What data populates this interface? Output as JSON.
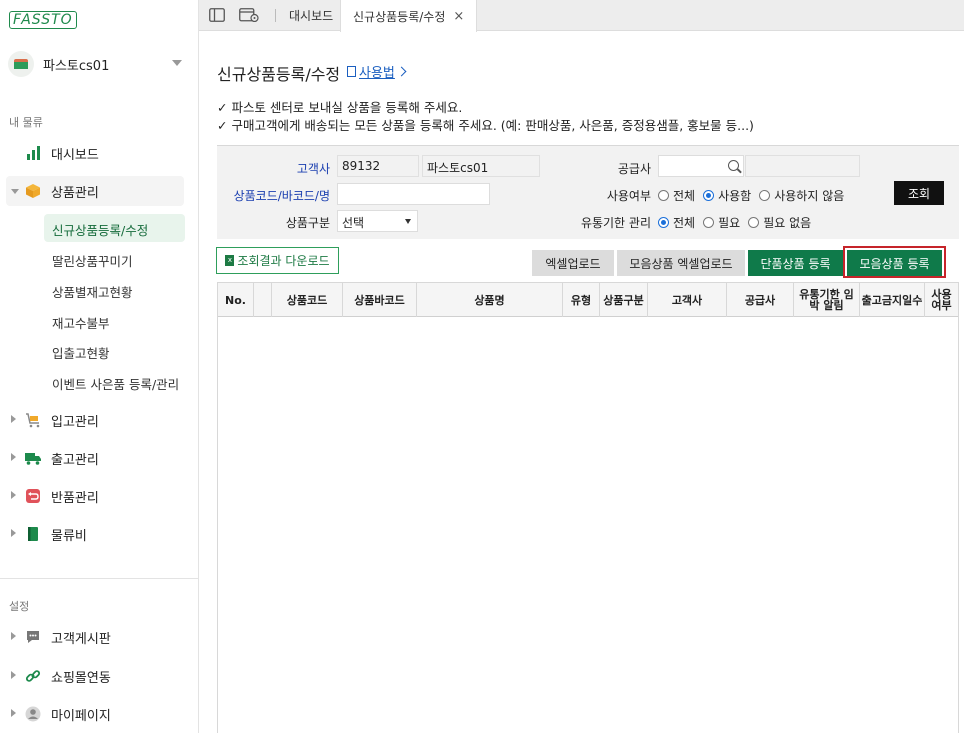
{
  "brand": {
    "logo_text": "FASSTO",
    "accent": "#0f7a4a"
  },
  "account": {
    "name": "파스토cs01"
  },
  "sidebar": {
    "section_main": "내 물류",
    "section_settings": "설정",
    "items": [
      {
        "label": "대시보드",
        "icon": "bar-chart-icon"
      },
      {
        "label": "상품관리",
        "icon": "box-icon"
      },
      {
        "label": "입고관리",
        "icon": "cart-icon"
      },
      {
        "label": "출고관리",
        "icon": "truck-icon"
      },
      {
        "label": "반품관리",
        "icon": "return-icon"
      },
      {
        "label": "물류비",
        "icon": "book-icon"
      }
    ],
    "sub_items": [
      "신규상품등록/수정",
      "딸린상품꾸미기",
      "상품별재고현황",
      "재고수불부",
      "입출고현황",
      "이벤트 사은품 등록/관리"
    ],
    "settings_items": [
      {
        "label": "고객게시판",
        "icon": "chat-icon"
      },
      {
        "label": "쇼핑몰연동",
        "icon": "link-icon"
      },
      {
        "label": "마이페이지",
        "icon": "user-icon"
      }
    ]
  },
  "tabs": [
    {
      "label": "대시보드"
    },
    {
      "label": "신규상품등록/수정",
      "close": "×"
    }
  ],
  "page": {
    "title": "신규상품등록/수정",
    "help_link": "사용법",
    "notices": [
      "✓ 파스토 센터로 보내실 상품을 등록해 주세요.",
      "✓ 구매고객에게 배송되는 모든 상품을 등록해 주세요. (예: 판매상품, 사은품, 증정용샘플, 홍보물 등...)"
    ]
  },
  "filters": {
    "customer_label": "고객사",
    "customer_code": "89132",
    "customer_name": "파스토cs01",
    "product_label": "상품코드/바코드/명",
    "product_value": "",
    "category_label": "상품구분",
    "category_value": "선택",
    "supplier_label": "공급사",
    "supplier_value": "",
    "supplier_name": "",
    "use_label": "사용여부",
    "use_options": [
      "전체",
      "사용함",
      "사용하지 않음"
    ],
    "expiry_label": "유통기한 관리",
    "expiry_options": [
      "전체",
      "필요",
      "필요 없음"
    ],
    "search_button": "조회"
  },
  "actions": {
    "download": "조회결과 다운로드",
    "excel_upload": "엑셀업로드",
    "bundle_excel_upload": "모음상품 엑셀업로드",
    "single_register": "단품상품 등록",
    "bundle_register": "모음상품 등록"
  },
  "grid": {
    "columns": [
      "No.",
      "",
      "상품코드",
      "상품바코드",
      "상품명",
      "유형",
      "상품구분",
      "고객사",
      "공급사",
      "유통기한 임박 알림",
      "출고금지일수",
      "사용 여부"
    ]
  }
}
